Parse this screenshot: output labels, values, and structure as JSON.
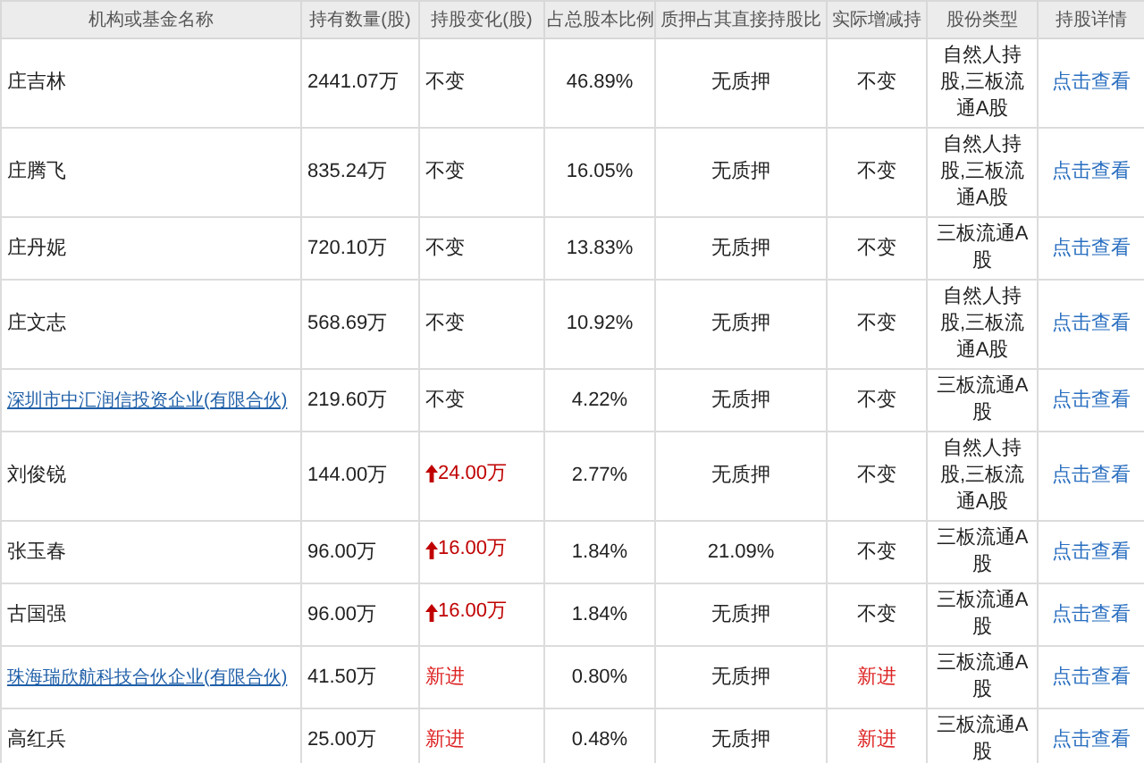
{
  "table": {
    "columns": [
      "机构或基金名称",
      "持有数量(股)",
      "持股变化(股)",
      "占总股本比例",
      "质押占其直接持股比",
      "实际增减持",
      "股份类型",
      "持股详情"
    ],
    "rows": [
      {
        "name": "庄吉林",
        "linked": false,
        "holding": "2441.07万",
        "change": {
          "kind": "same",
          "text": "不变"
        },
        "ratio": "46.89%",
        "pledge": "无质押",
        "actual": {
          "kind": "same",
          "text": "不变"
        },
        "share_type": "自然人持股,三板流通A股",
        "detail": "点击查看"
      },
      {
        "name": "庄腾飞",
        "linked": false,
        "holding": "835.24万",
        "change": {
          "kind": "same",
          "text": "不变"
        },
        "ratio": "16.05%",
        "pledge": "无质押",
        "actual": {
          "kind": "same",
          "text": "不变"
        },
        "share_type": "自然人持股,三板流通A股",
        "detail": "点击查看"
      },
      {
        "name": "庄丹妮",
        "linked": false,
        "holding": "720.10万",
        "change": {
          "kind": "same",
          "text": "不变"
        },
        "ratio": "13.83%",
        "pledge": "无质押",
        "actual": {
          "kind": "same",
          "text": "不变"
        },
        "share_type": "三板流通A股",
        "detail": "点击查看"
      },
      {
        "name": "庄文志",
        "linked": false,
        "holding": "568.69万",
        "change": {
          "kind": "same",
          "text": "不变"
        },
        "ratio": "10.92%",
        "pledge": "无质押",
        "actual": {
          "kind": "same",
          "text": "不变"
        },
        "share_type": "自然人持股,三板流通A股",
        "detail": "点击查看"
      },
      {
        "name": "深圳市中汇润信投资企业(有限合伙)",
        "linked": true,
        "holding": "219.60万",
        "change": {
          "kind": "same",
          "text": "不变"
        },
        "ratio": "4.22%",
        "pledge": "无质押",
        "actual": {
          "kind": "same",
          "text": "不变"
        },
        "share_type": "三板流通A股",
        "detail": "点击查看"
      },
      {
        "name": "刘俊锐",
        "linked": false,
        "holding": "144.00万",
        "change": {
          "kind": "up",
          "text": "24.00万"
        },
        "ratio": "2.77%",
        "pledge": "无质押",
        "actual": {
          "kind": "same",
          "text": "不变"
        },
        "share_type": "自然人持股,三板流通A股",
        "detail": "点击查看"
      },
      {
        "name": "张玉春",
        "linked": false,
        "holding": "96.00万",
        "change": {
          "kind": "up",
          "text": "16.00万"
        },
        "ratio": "1.84%",
        "pledge": "21.09%",
        "actual": {
          "kind": "same",
          "text": "不变"
        },
        "share_type": "三板流通A股",
        "detail": "点击查看"
      },
      {
        "name": "古国强",
        "linked": false,
        "holding": "96.00万",
        "change": {
          "kind": "up",
          "text": "16.00万"
        },
        "ratio": "1.84%",
        "pledge": "无质押",
        "actual": {
          "kind": "same",
          "text": "不变"
        },
        "share_type": "三板流通A股",
        "detail": "点击查看"
      },
      {
        "name": "珠海瑞欣航科技合伙企业(有限合伙)",
        "linked": true,
        "holding": "41.50万",
        "change": {
          "kind": "new",
          "text": "新进"
        },
        "ratio": "0.80%",
        "pledge": "无质押",
        "actual": {
          "kind": "new",
          "text": "新进"
        },
        "share_type": "三板流通A股",
        "detail": "点击查看"
      },
      {
        "name": "高红兵",
        "linked": false,
        "holding": "25.00万",
        "change": {
          "kind": "new",
          "text": "新进"
        },
        "ratio": "0.48%",
        "pledge": "无质押",
        "actual": {
          "kind": "new",
          "text": "新进"
        },
        "share_type": "三板流通A股",
        "detail": "点击查看"
      }
    ]
  }
}
